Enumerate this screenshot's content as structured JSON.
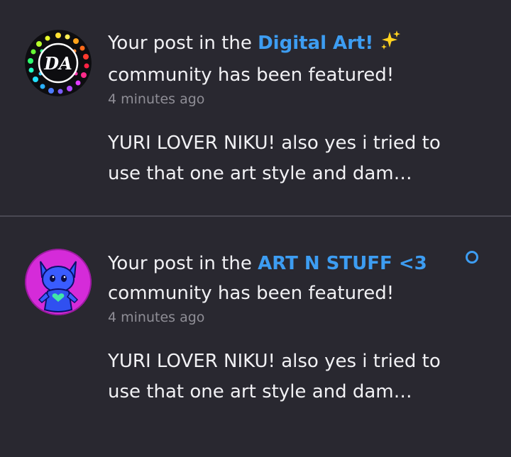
{
  "notifications": [
    {
      "headline_prefix": "Your post in the",
      "community": "Digital Art!",
      "sparkle": "✨",
      "headline_suffix": "community has been featured!",
      "time": "4 minutes ago",
      "excerpt": "YURI LOVER NIKU! also yes i tried to use that one art style and dam…",
      "avatar_text": "DA",
      "avatar_icon": "digital-art-logo",
      "unread": false
    },
    {
      "headline_prefix": "Your post in the",
      "community": "ART N STUFF <3",
      "headline_suffix": "community has been featured!",
      "time": "4 minutes ago",
      "excerpt": "YURI LOVER NIKU! also yes i tried to use that one art style and dam…",
      "avatar_icon": "blue-character-avatar",
      "unread": true
    }
  ],
  "colors": {
    "background": "#292830",
    "link": "#3d9df2",
    "text": "#f1f1f4",
    "muted": "#8f8e96",
    "divider": "#4a4953"
  }
}
